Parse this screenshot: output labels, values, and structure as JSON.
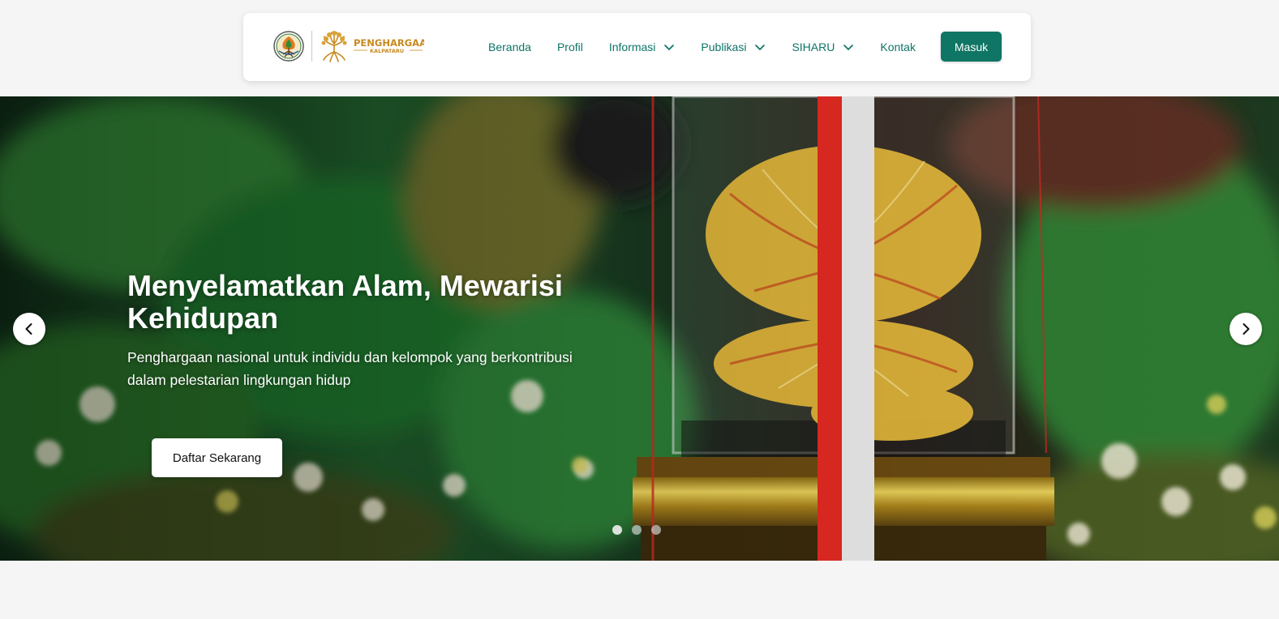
{
  "navbar": {
    "brand": {
      "logo_line1": "PENGHARGAAN",
      "logo_line2": "KALPATARU",
      "accent_color": "#c88a1e"
    },
    "links": [
      {
        "label": "Beranda",
        "has_dropdown": false
      },
      {
        "label": "Profil",
        "has_dropdown": false
      },
      {
        "label": "Informasi",
        "has_dropdown": true
      },
      {
        "label": "Publikasi",
        "has_dropdown": true
      },
      {
        "label": "SIHARU",
        "has_dropdown": true
      },
      {
        "label": "Kontak",
        "has_dropdown": false
      }
    ],
    "login_label": "Masuk",
    "link_color": "#0d7466",
    "button_color": "#0f7564"
  },
  "hero": {
    "title": "Menyelamatkan Alam, Mewarisi Kehidupan",
    "subtitle": "Penghargaan nasional untuk individu dan kelompok yang berkontribusi dalam pelestarian lingkungan hidup",
    "cta_label": "Daftar Sekarang",
    "slides": 3,
    "active_slide": 1,
    "prev_icon": "chevron-left-icon",
    "next_icon": "chevron-right-icon"
  }
}
